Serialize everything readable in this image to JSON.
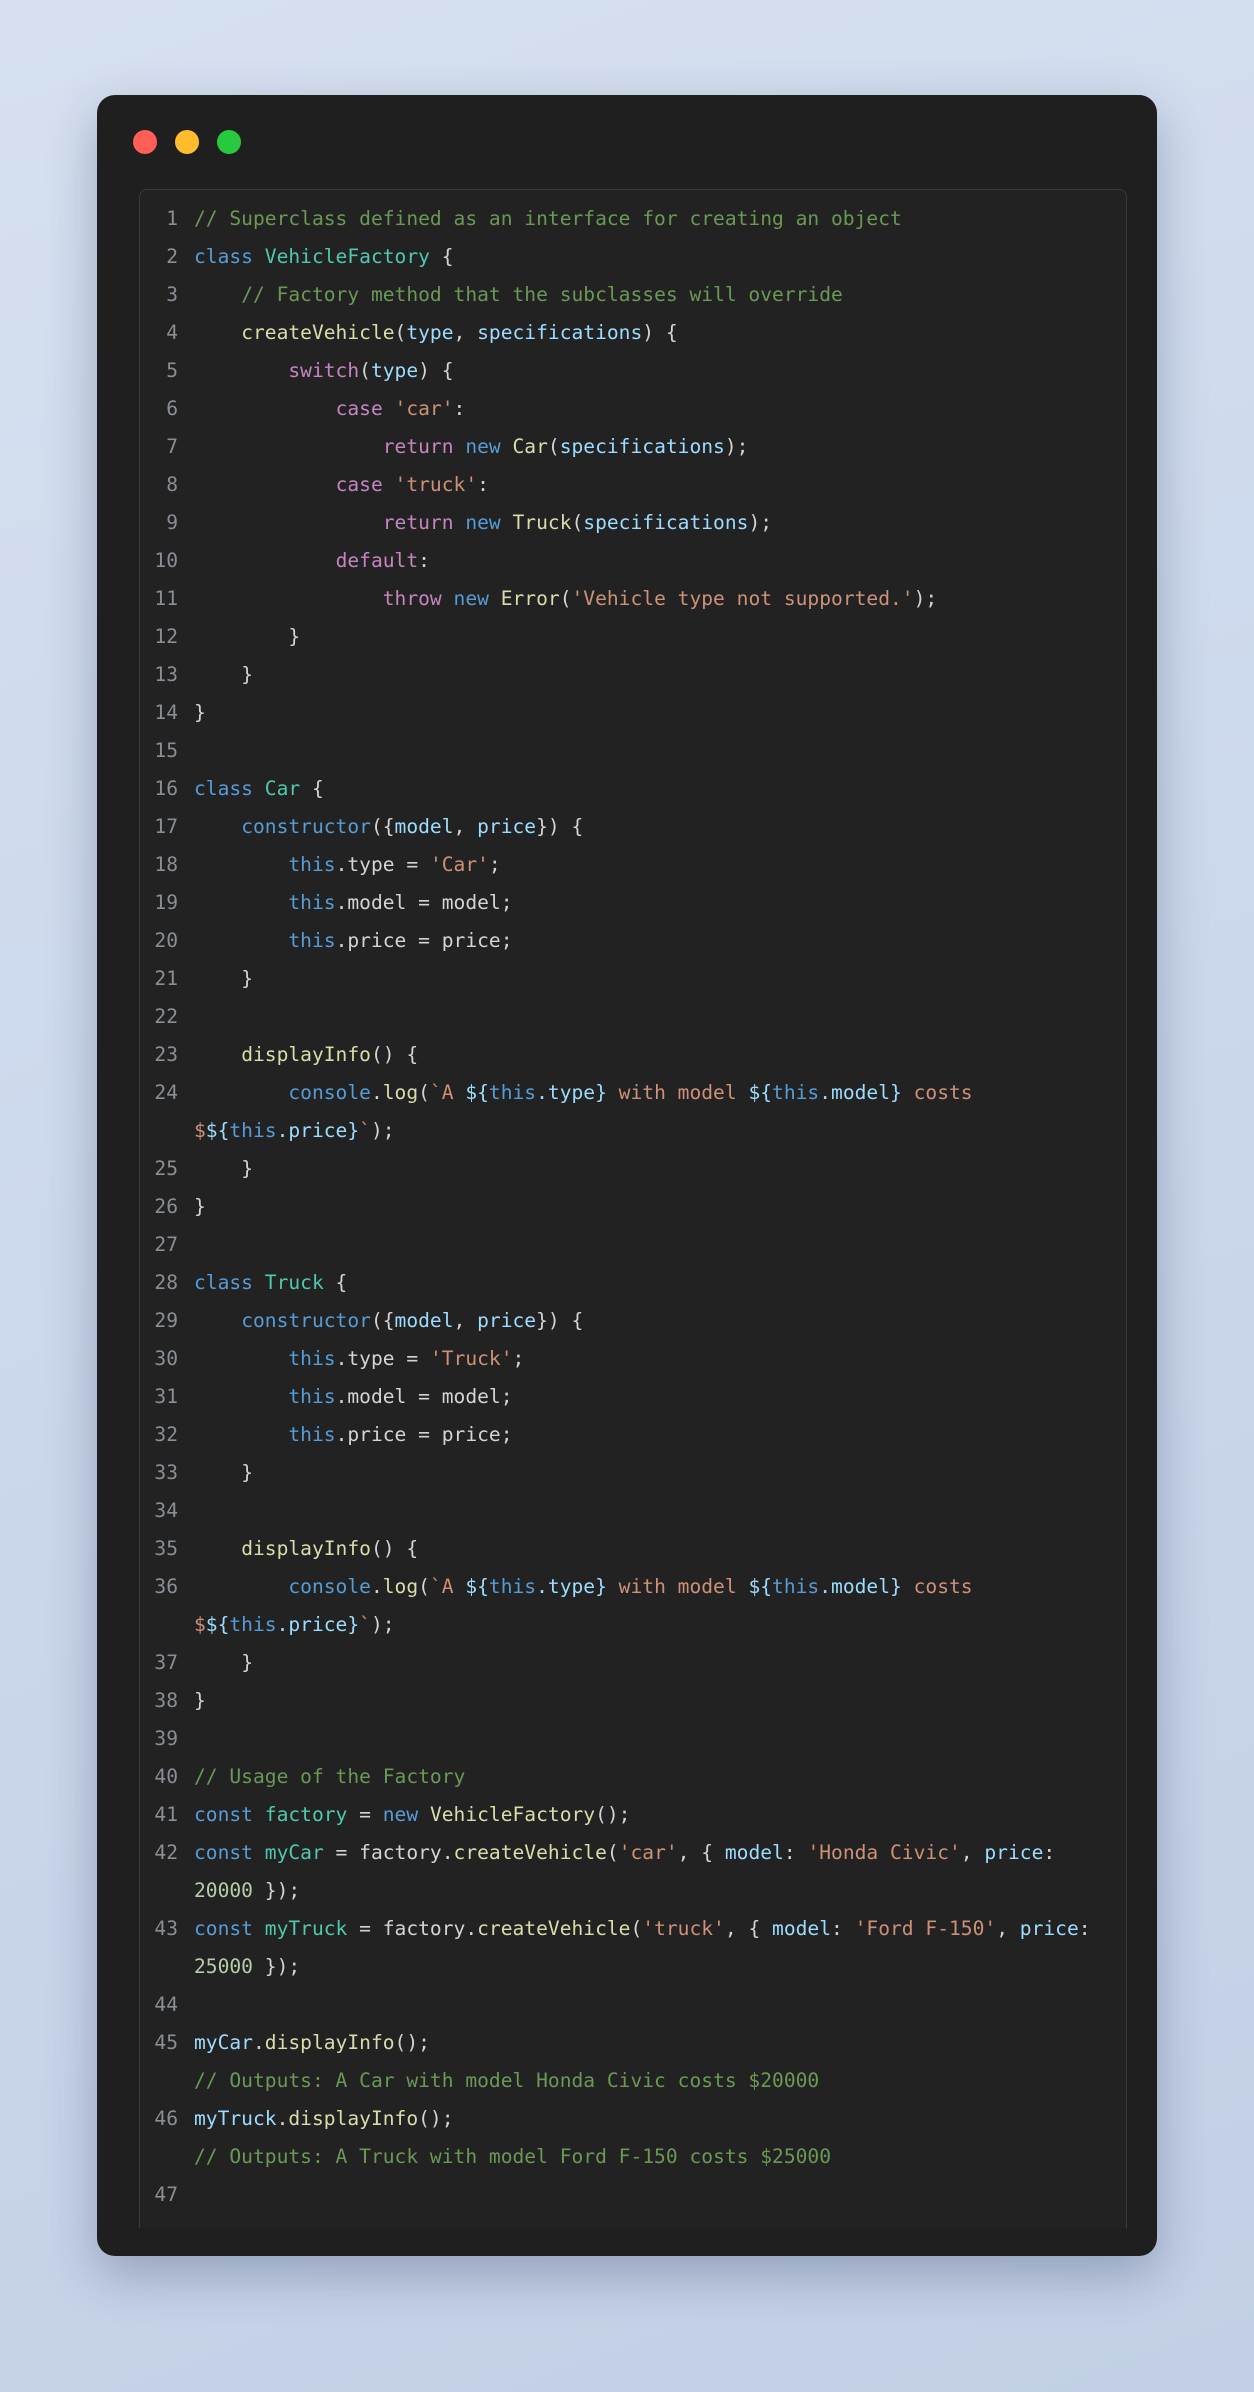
{
  "window": {
    "traffic_lights": [
      {
        "name": "close",
        "color": "#ff5f56"
      },
      {
        "name": "minimize",
        "color": "#ffbd2e"
      },
      {
        "name": "maximize",
        "color": "#27c93f"
      }
    ]
  },
  "editor": {
    "language": "javascript",
    "theme": "dark",
    "background": "#222222",
    "chrome_background": "#1f1f1f",
    "line_number_color": "#8a8f95",
    "colors": {
      "comment": "#6a9955",
      "keyword": "#569cd6",
      "control": "#c586c0",
      "class": "#4ec9b0",
      "function": "#dcdcaa",
      "variable": "#9cdcfe",
      "string": "#ce9178",
      "number": "#b5cea8",
      "plain": "#d4d4d4"
    },
    "first_line": 1,
    "last_line": 47,
    "lines": [
      {
        "n": "1",
        "tokens": [
          {
            "t": "// Superclass defined as an interface for creating an object",
            "c": "cm"
          }
        ]
      },
      {
        "n": "2",
        "tokens": [
          {
            "t": "class",
            "c": "kw"
          },
          {
            "t": " ",
            "c": "pl"
          },
          {
            "t": "VehicleFactory",
            "c": "cls"
          },
          {
            "t": " {",
            "c": "pl"
          }
        ]
      },
      {
        "n": "3",
        "tokens": [
          {
            "t": "    ",
            "c": "pl"
          },
          {
            "t": "// Factory method that the subclasses will override",
            "c": "cm"
          }
        ]
      },
      {
        "n": "4",
        "tokens": [
          {
            "t": "    ",
            "c": "pl"
          },
          {
            "t": "createVehicle",
            "c": "fn"
          },
          {
            "t": "(",
            "c": "pl"
          },
          {
            "t": "type",
            "c": "var"
          },
          {
            "t": ", ",
            "c": "pl"
          },
          {
            "t": "specifications",
            "c": "var"
          },
          {
            "t": ") {",
            "c": "pl"
          }
        ]
      },
      {
        "n": "5",
        "tokens": [
          {
            "t": "        ",
            "c": "pl"
          },
          {
            "t": "switch",
            "c": "ctl"
          },
          {
            "t": "(",
            "c": "pl"
          },
          {
            "t": "type",
            "c": "var"
          },
          {
            "t": ") {",
            "c": "pl"
          }
        ]
      },
      {
        "n": "6",
        "tokens": [
          {
            "t": "            ",
            "c": "pl"
          },
          {
            "t": "case",
            "c": "ctl"
          },
          {
            "t": " ",
            "c": "pl"
          },
          {
            "t": "'car'",
            "c": "str"
          },
          {
            "t": ":",
            "c": "pl"
          }
        ]
      },
      {
        "n": "7",
        "tokens": [
          {
            "t": "                ",
            "c": "pl"
          },
          {
            "t": "return",
            "c": "ctl"
          },
          {
            "t": " ",
            "c": "pl"
          },
          {
            "t": "new",
            "c": "kw"
          },
          {
            "t": " ",
            "c": "pl"
          },
          {
            "t": "Car",
            "c": "fn"
          },
          {
            "t": "(",
            "c": "pl"
          },
          {
            "t": "specifications",
            "c": "var"
          },
          {
            "t": ");",
            "c": "pl"
          }
        ]
      },
      {
        "n": "8",
        "tokens": [
          {
            "t": "            ",
            "c": "pl"
          },
          {
            "t": "case",
            "c": "ctl"
          },
          {
            "t": " ",
            "c": "pl"
          },
          {
            "t": "'truck'",
            "c": "str"
          },
          {
            "t": ":",
            "c": "pl"
          }
        ]
      },
      {
        "n": "9",
        "tokens": [
          {
            "t": "                ",
            "c": "pl"
          },
          {
            "t": "return",
            "c": "ctl"
          },
          {
            "t": " ",
            "c": "pl"
          },
          {
            "t": "new",
            "c": "kw"
          },
          {
            "t": " ",
            "c": "pl"
          },
          {
            "t": "Truck",
            "c": "fn"
          },
          {
            "t": "(",
            "c": "pl"
          },
          {
            "t": "specifications",
            "c": "var"
          },
          {
            "t": ");",
            "c": "pl"
          }
        ]
      },
      {
        "n": "10",
        "tokens": [
          {
            "t": "            ",
            "c": "pl"
          },
          {
            "t": "default",
            "c": "ctl"
          },
          {
            "t": ":",
            "c": "pl"
          }
        ]
      },
      {
        "n": "11",
        "tokens": [
          {
            "t": "                ",
            "c": "pl"
          },
          {
            "t": "throw",
            "c": "ctl"
          },
          {
            "t": " ",
            "c": "pl"
          },
          {
            "t": "new",
            "c": "kw"
          },
          {
            "t": " ",
            "c": "pl"
          },
          {
            "t": "Error",
            "c": "fn"
          },
          {
            "t": "(",
            "c": "pl"
          },
          {
            "t": "'Vehicle type not supported.'",
            "c": "str"
          },
          {
            "t": ");",
            "c": "pl"
          }
        ]
      },
      {
        "n": "12",
        "tokens": [
          {
            "t": "        }",
            "c": "pl"
          }
        ]
      },
      {
        "n": "13",
        "tokens": [
          {
            "t": "    }",
            "c": "pl"
          }
        ]
      },
      {
        "n": "14",
        "tokens": [
          {
            "t": "}",
            "c": "pl"
          }
        ]
      },
      {
        "n": "15",
        "tokens": []
      },
      {
        "n": "16",
        "tokens": [
          {
            "t": "class",
            "c": "kw"
          },
          {
            "t": " ",
            "c": "pl"
          },
          {
            "t": "Car",
            "c": "cls"
          },
          {
            "t": " {",
            "c": "pl"
          }
        ]
      },
      {
        "n": "17",
        "tokens": [
          {
            "t": "    ",
            "c": "pl"
          },
          {
            "t": "constructor",
            "c": "kw"
          },
          {
            "t": "({",
            "c": "pl"
          },
          {
            "t": "model",
            "c": "var"
          },
          {
            "t": ", ",
            "c": "pl"
          },
          {
            "t": "price",
            "c": "var"
          },
          {
            "t": "}) {",
            "c": "pl"
          }
        ]
      },
      {
        "n": "18",
        "tokens": [
          {
            "t": "        ",
            "c": "pl"
          },
          {
            "t": "this",
            "c": "kw"
          },
          {
            "t": ".type = ",
            "c": "pl"
          },
          {
            "t": "'Car'",
            "c": "str"
          },
          {
            "t": ";",
            "c": "pl"
          }
        ]
      },
      {
        "n": "19",
        "tokens": [
          {
            "t": "        ",
            "c": "pl"
          },
          {
            "t": "this",
            "c": "kw"
          },
          {
            "t": ".model = model;",
            "c": "pl"
          }
        ]
      },
      {
        "n": "20",
        "tokens": [
          {
            "t": "        ",
            "c": "pl"
          },
          {
            "t": "this",
            "c": "kw"
          },
          {
            "t": ".price = price;",
            "c": "pl"
          }
        ]
      },
      {
        "n": "21",
        "tokens": [
          {
            "t": "    }",
            "c": "pl"
          }
        ]
      },
      {
        "n": "22",
        "tokens": []
      },
      {
        "n": "23",
        "tokens": [
          {
            "t": "    ",
            "c": "pl"
          },
          {
            "t": "displayInfo",
            "c": "fn"
          },
          {
            "t": "() {",
            "c": "pl"
          }
        ]
      },
      {
        "n": "24",
        "tokens": [
          {
            "t": "        ",
            "c": "pl"
          },
          {
            "t": "console",
            "c": "kw"
          },
          {
            "t": ".",
            "c": "pl"
          },
          {
            "t": "log",
            "c": "fn"
          },
          {
            "t": "(",
            "c": "pl"
          },
          {
            "t": "`A ",
            "c": "str"
          },
          {
            "t": "${",
            "c": "var"
          },
          {
            "t": "this",
            "c": "kw"
          },
          {
            "t": ".type",
            "c": "var"
          },
          {
            "t": "}",
            "c": "var"
          },
          {
            "t": " with model ",
            "c": "str"
          },
          {
            "t": "${",
            "c": "var"
          },
          {
            "t": "this",
            "c": "kw"
          },
          {
            "t": ".model",
            "c": "var"
          },
          {
            "t": "}",
            "c": "var"
          },
          {
            "t": " costs $",
            "c": "str"
          },
          {
            "t": "${",
            "c": "var"
          },
          {
            "t": "this",
            "c": "kw"
          },
          {
            "t": ".price",
            "c": "var"
          },
          {
            "t": "}",
            "c": "var"
          },
          {
            "t": "`",
            "c": "str"
          },
          {
            "t": ");",
            "c": "pl"
          }
        ]
      },
      {
        "n": "25",
        "tokens": [
          {
            "t": "    }",
            "c": "pl"
          }
        ]
      },
      {
        "n": "26",
        "tokens": [
          {
            "t": "}",
            "c": "pl"
          }
        ]
      },
      {
        "n": "27",
        "tokens": []
      },
      {
        "n": "28",
        "tokens": [
          {
            "t": "class",
            "c": "kw"
          },
          {
            "t": " ",
            "c": "pl"
          },
          {
            "t": "Truck",
            "c": "cls"
          },
          {
            "t": " {",
            "c": "pl"
          }
        ]
      },
      {
        "n": "29",
        "tokens": [
          {
            "t": "    ",
            "c": "pl"
          },
          {
            "t": "constructor",
            "c": "kw"
          },
          {
            "t": "({",
            "c": "pl"
          },
          {
            "t": "model",
            "c": "var"
          },
          {
            "t": ", ",
            "c": "pl"
          },
          {
            "t": "price",
            "c": "var"
          },
          {
            "t": "}) {",
            "c": "pl"
          }
        ]
      },
      {
        "n": "30",
        "tokens": [
          {
            "t": "        ",
            "c": "pl"
          },
          {
            "t": "this",
            "c": "kw"
          },
          {
            "t": ".type = ",
            "c": "pl"
          },
          {
            "t": "'Truck'",
            "c": "str"
          },
          {
            "t": ";",
            "c": "pl"
          }
        ]
      },
      {
        "n": "31",
        "tokens": [
          {
            "t": "        ",
            "c": "pl"
          },
          {
            "t": "this",
            "c": "kw"
          },
          {
            "t": ".model = model;",
            "c": "pl"
          }
        ]
      },
      {
        "n": "32",
        "tokens": [
          {
            "t": "        ",
            "c": "pl"
          },
          {
            "t": "this",
            "c": "kw"
          },
          {
            "t": ".price = price;",
            "c": "pl"
          }
        ]
      },
      {
        "n": "33",
        "tokens": [
          {
            "t": "    }",
            "c": "pl"
          }
        ]
      },
      {
        "n": "34",
        "tokens": []
      },
      {
        "n": "35",
        "tokens": [
          {
            "t": "    ",
            "c": "pl"
          },
          {
            "t": "displayInfo",
            "c": "fn"
          },
          {
            "t": "() {",
            "c": "pl"
          }
        ]
      },
      {
        "n": "36",
        "tokens": [
          {
            "t": "        ",
            "c": "pl"
          },
          {
            "t": "console",
            "c": "kw"
          },
          {
            "t": ".",
            "c": "pl"
          },
          {
            "t": "log",
            "c": "fn"
          },
          {
            "t": "(",
            "c": "pl"
          },
          {
            "t": "`A ",
            "c": "str"
          },
          {
            "t": "${",
            "c": "var"
          },
          {
            "t": "this",
            "c": "kw"
          },
          {
            "t": ".type",
            "c": "var"
          },
          {
            "t": "}",
            "c": "var"
          },
          {
            "t": " with model ",
            "c": "str"
          },
          {
            "t": "${",
            "c": "var"
          },
          {
            "t": "this",
            "c": "kw"
          },
          {
            "t": ".model",
            "c": "var"
          },
          {
            "t": "}",
            "c": "var"
          },
          {
            "t": " costs $",
            "c": "str"
          },
          {
            "t": "${",
            "c": "var"
          },
          {
            "t": "this",
            "c": "kw"
          },
          {
            "t": ".price",
            "c": "var"
          },
          {
            "t": "}",
            "c": "var"
          },
          {
            "t": "`",
            "c": "str"
          },
          {
            "t": ");",
            "c": "pl"
          }
        ]
      },
      {
        "n": "37",
        "tokens": [
          {
            "t": "    }",
            "c": "pl"
          }
        ]
      },
      {
        "n": "38",
        "tokens": [
          {
            "t": "}",
            "c": "pl"
          }
        ]
      },
      {
        "n": "39",
        "tokens": []
      },
      {
        "n": "40",
        "tokens": [
          {
            "t": "// Usage of the Factory",
            "c": "cm"
          }
        ]
      },
      {
        "n": "41",
        "tokens": [
          {
            "t": "const",
            "c": "kw"
          },
          {
            "t": " ",
            "c": "pl"
          },
          {
            "t": "factory",
            "c": "cls"
          },
          {
            "t": " = ",
            "c": "pl"
          },
          {
            "t": "new",
            "c": "kw"
          },
          {
            "t": " ",
            "c": "pl"
          },
          {
            "t": "VehicleFactory",
            "c": "fn"
          },
          {
            "t": "();",
            "c": "pl"
          }
        ]
      },
      {
        "n": "42",
        "tokens": [
          {
            "t": "const",
            "c": "kw"
          },
          {
            "t": " ",
            "c": "pl"
          },
          {
            "t": "myCar",
            "c": "cls"
          },
          {
            "t": " = factory.",
            "c": "pl"
          },
          {
            "t": "createVehicle",
            "c": "fn"
          },
          {
            "t": "(",
            "c": "pl"
          },
          {
            "t": "'car'",
            "c": "str"
          },
          {
            "t": ", { ",
            "c": "pl"
          },
          {
            "t": "model",
            "c": "var"
          },
          {
            "t": ": ",
            "c": "pl"
          },
          {
            "t": "'Honda Civic'",
            "c": "str"
          },
          {
            "t": ", ",
            "c": "pl"
          },
          {
            "t": "price",
            "c": "var"
          },
          {
            "t": ": ",
            "c": "pl"
          },
          {
            "t": "20000",
            "c": "num"
          },
          {
            "t": " });",
            "c": "pl"
          }
        ]
      },
      {
        "n": "43",
        "tokens": [
          {
            "t": "const",
            "c": "kw"
          },
          {
            "t": " ",
            "c": "pl"
          },
          {
            "t": "myTruck",
            "c": "cls"
          },
          {
            "t": " = factory.",
            "c": "pl"
          },
          {
            "t": "createVehicle",
            "c": "fn"
          },
          {
            "t": "(",
            "c": "pl"
          },
          {
            "t": "'truck'",
            "c": "str"
          },
          {
            "t": ", { ",
            "c": "pl"
          },
          {
            "t": "model",
            "c": "var"
          },
          {
            "t": ": ",
            "c": "pl"
          },
          {
            "t": "'Ford F-150'",
            "c": "str"
          },
          {
            "t": ", ",
            "c": "pl"
          },
          {
            "t": "price",
            "c": "var"
          },
          {
            "t": ": ",
            "c": "pl"
          },
          {
            "t": "25000",
            "c": "num"
          },
          {
            "t": " });",
            "c": "pl"
          }
        ]
      },
      {
        "n": "44",
        "tokens": []
      },
      {
        "n": "45",
        "tokens": [
          {
            "t": "myCar",
            "c": "var"
          },
          {
            "t": ".",
            "c": "pl"
          },
          {
            "t": "displayInfo",
            "c": "fn"
          },
          {
            "t": "();",
            "c": "pl"
          },
          {
            "t": "\n",
            "c": "pl"
          },
          {
            "t": "// Outputs: A Car with model Honda Civic costs $20000",
            "c": "cm"
          }
        ]
      },
      {
        "n": "46",
        "tokens": [
          {
            "t": "myTruck",
            "c": "var"
          },
          {
            "t": ".",
            "c": "pl"
          },
          {
            "t": "displayInfo",
            "c": "fn"
          },
          {
            "t": "();",
            "c": "pl"
          },
          {
            "t": "\n",
            "c": "pl"
          },
          {
            "t": "// Outputs: A Truck with model Ford F-150 costs $25000",
            "c": "cm"
          }
        ]
      },
      {
        "n": "47",
        "tokens": []
      }
    ]
  }
}
